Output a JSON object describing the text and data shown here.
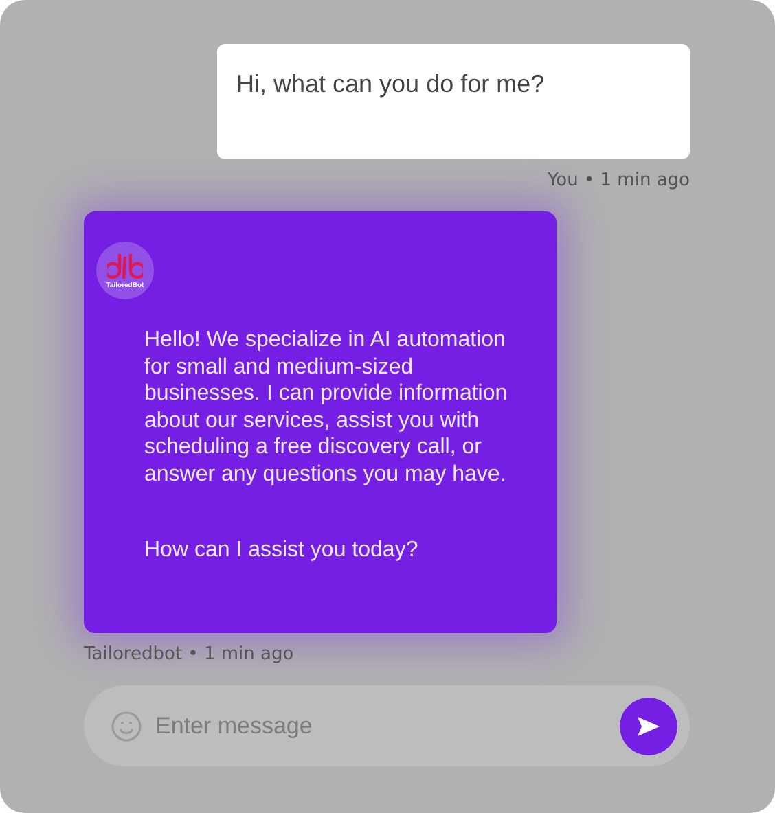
{
  "messages": [
    {
      "kind": "user",
      "text": [
        "Hi, what can you do for me?"
      ],
      "meta": "You • 1 min ago"
    },
    {
      "kind": "bot",
      "avatar_text": "TailoredBot",
      "text": [
        "Hello! We specialize in AI automation for small and medium-sized businesses. I can provide information about our services, assist you with scheduling a free discovery call, or answer any questions you may have.",
        "How can I assist you today?"
      ],
      "meta": "Tailoredbot • 1 min ago"
    }
  ],
  "composer": {
    "placeholder": "Enter message"
  }
}
